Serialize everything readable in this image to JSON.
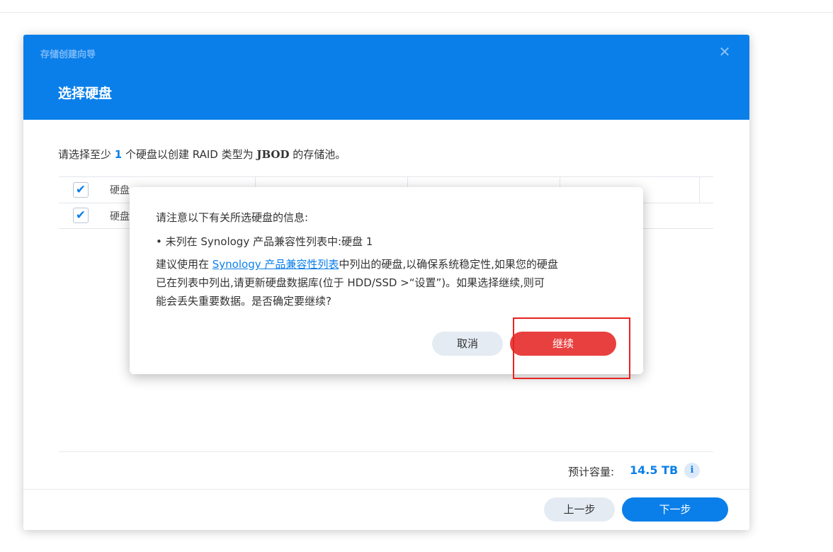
{
  "wizard": {
    "app_title": "存储创建向导",
    "close_glyph": "✕",
    "step_title": "选择硬盘",
    "instruction": {
      "prefix": "请选择至少 ",
      "count": "1",
      "middle": " 个硬盘以创建 RAID 类型为 ",
      "raid_type": "JBOD",
      "suffix": " 的存储池。"
    },
    "table": {
      "header_partial": "硬盘",
      "row_partial": "硬盘",
      "check_glyph": "✔"
    },
    "capacity": {
      "label": "预计容量:",
      "value": "14.5 TB",
      "info_glyph": "i"
    },
    "buttons": {
      "prev": "上一步",
      "next": "下一步"
    }
  },
  "dialog": {
    "heading": "请注意以下有关所选硬盘的信息:",
    "bullet": "•  未列在 Synology 产品兼容性列表中:硬盘 1",
    "body_prefix": "建议使用在 ",
    "link_text": "Synology 产品兼容性列表",
    "body_line1_rest": "中列出的硬盘,以确保系统稳定性,如果您的硬盘",
    "body_line2": "已在列表中列出,请更新硬盘数据库(位于 HDD/SSD >“设置”)。如果选择继续,则可",
    "body_line3": "能会丢失重要数据。是否确定要继续?",
    "buttons": {
      "cancel": "取消",
      "continue": "继续"
    }
  },
  "colors": {
    "accent": "#0a7fea",
    "danger": "#e8403f",
    "highlight": "#e8231f"
  }
}
